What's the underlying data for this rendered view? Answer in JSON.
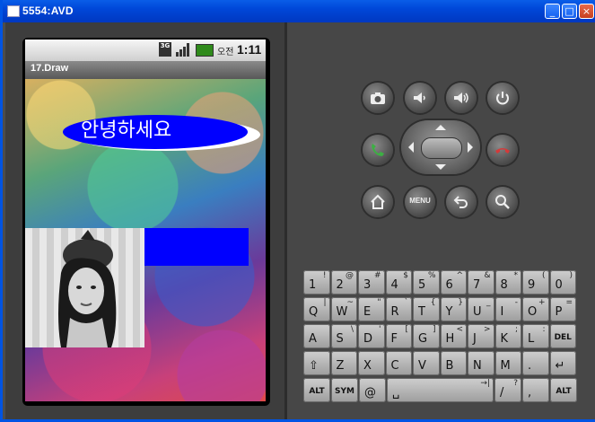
{
  "window": {
    "title": "5554:AVD",
    "controls": {
      "minimize": "_",
      "maximize": "□",
      "close": "×"
    }
  },
  "status_bar": {
    "network": "3G",
    "ampm": "오전",
    "time": "1:11"
  },
  "app": {
    "title": "17.Draw",
    "greeting": "안녕하세요"
  },
  "hardware_buttons": {
    "menu_label": "MENU"
  },
  "keyboard": {
    "rows": [
      [
        {
          "m": "1",
          "s": "!"
        },
        {
          "m": "2",
          "s": "@"
        },
        {
          "m": "3",
          "s": "#"
        },
        {
          "m": "4",
          "s": "$"
        },
        {
          "m": "5",
          "s": "%"
        },
        {
          "m": "6",
          "s": "^"
        },
        {
          "m": "7",
          "s": "&"
        },
        {
          "m": "8",
          "s": "*"
        },
        {
          "m": "9",
          "s": "("
        },
        {
          "m": "0",
          "s": ")"
        }
      ],
      [
        {
          "m": "Q",
          "s": "|"
        },
        {
          "m": "W",
          "s": "~"
        },
        {
          "m": "E",
          "s": "\""
        },
        {
          "m": "R",
          "s": "`"
        },
        {
          "m": "T",
          "s": "{"
        },
        {
          "m": "Y",
          "s": "}"
        },
        {
          "m": "U",
          "s": "_"
        },
        {
          "m": "I",
          "s": "-"
        },
        {
          "m": "O",
          "s": "+"
        },
        {
          "m": "P",
          "s": "="
        }
      ],
      [
        {
          "m": "A",
          "s": ""
        },
        {
          "m": "S",
          "s": "\\"
        },
        {
          "m": "D",
          "s": "'"
        },
        {
          "m": "F",
          "s": "["
        },
        {
          "m": "G",
          "s": "]"
        },
        {
          "m": "H",
          "s": "<"
        },
        {
          "m": "J",
          "s": ">"
        },
        {
          "m": "K",
          "s": ";"
        },
        {
          "m": "L",
          "s": ":"
        },
        {
          "m": "DEL",
          "s": ""
        }
      ],
      [
        {
          "m": "⇧",
          "s": ""
        },
        {
          "m": "Z",
          "s": ""
        },
        {
          "m": "X",
          "s": ""
        },
        {
          "m": "C",
          "s": ""
        },
        {
          "m": "V",
          "s": ""
        },
        {
          "m": "B",
          "s": ""
        },
        {
          "m": "N",
          "s": ""
        },
        {
          "m": "M",
          "s": ""
        },
        {
          "m": ".",
          "s": ""
        },
        {
          "m": "↵",
          "s": ""
        }
      ],
      [
        {
          "m": "ALT",
          "s": ""
        },
        {
          "m": "SYM",
          "s": ""
        },
        {
          "m": "@",
          "s": ""
        },
        {
          "m": "␣",
          "s": "→|"
        },
        {
          "m": "/",
          "s": "?"
        },
        {
          "m": ",",
          "s": ""
        },
        {
          "m": "ALT",
          "s": ""
        }
      ]
    ]
  }
}
